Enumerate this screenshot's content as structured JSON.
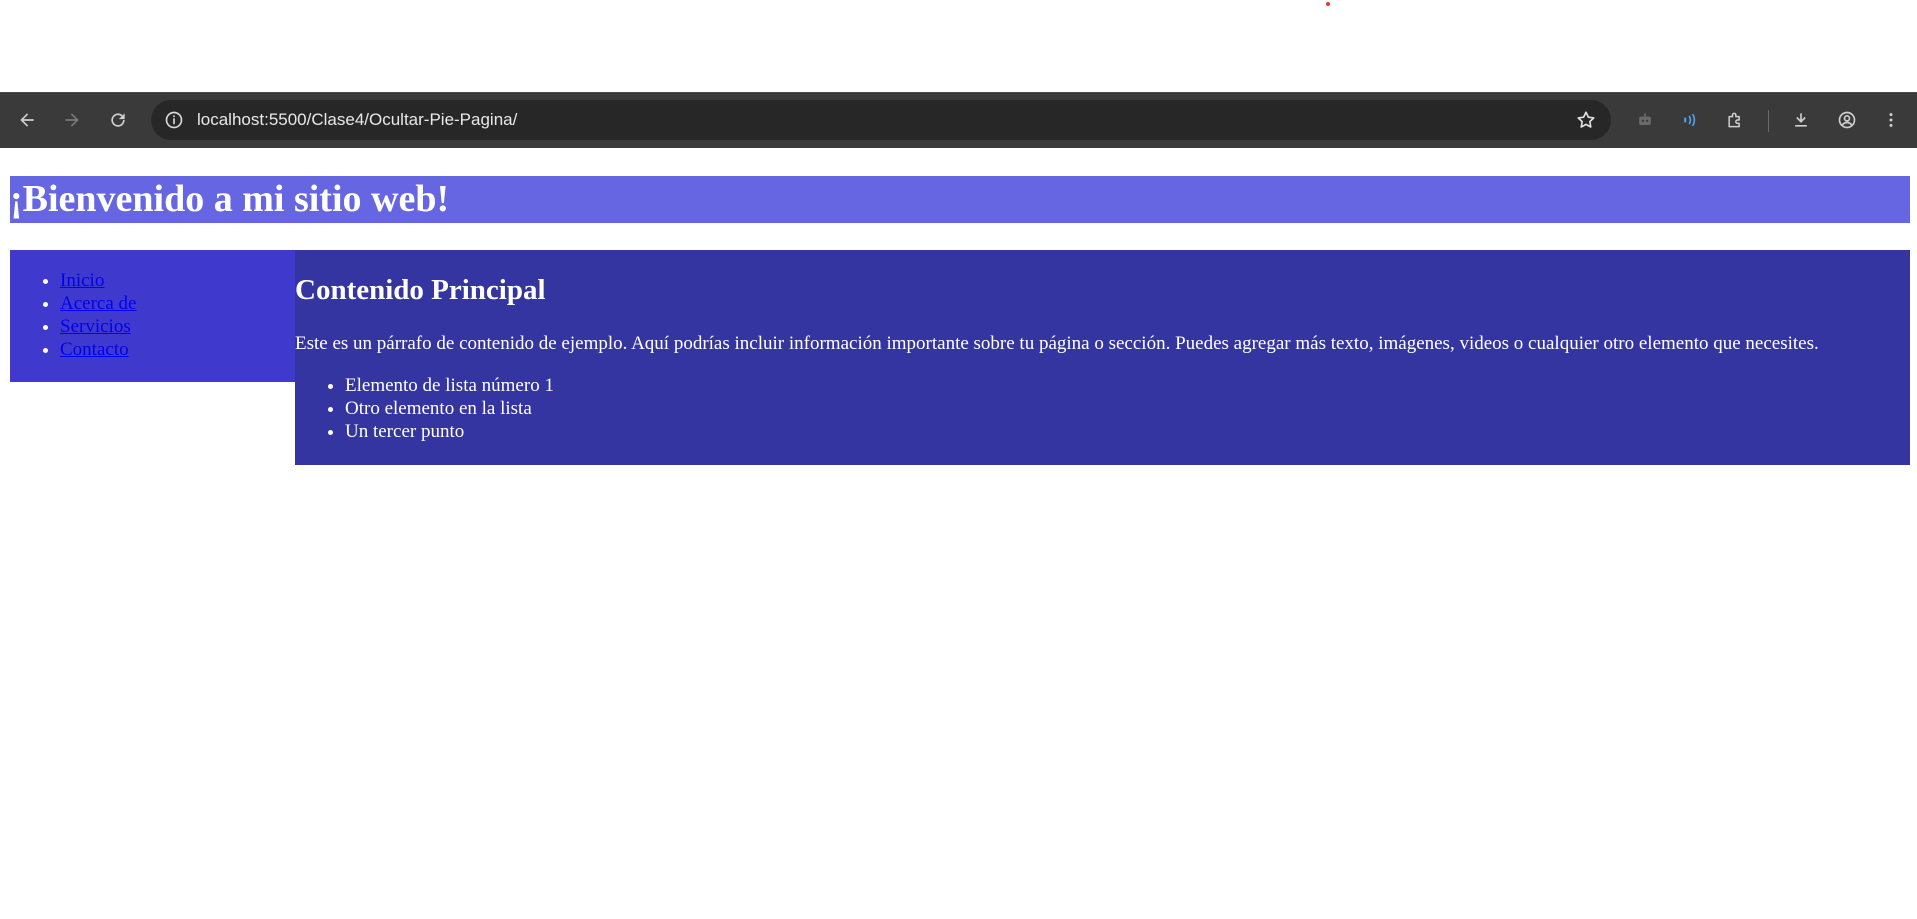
{
  "browser": {
    "url": "localhost:5500/Clase4/Ocultar-Pie-Pagina/"
  },
  "colors": {
    "toolbar": "#3a3a3a",
    "urlbar": "#272727",
    "header_bg": "#6666e2",
    "sidebar_bg": "#3f3acd",
    "main_bg": "#3535a2",
    "link": "#0000ee",
    "accent_blue": "#4aa3f0"
  },
  "header": {
    "title": "¡Bienvenido a mi sitio web!"
  },
  "sidebar": {
    "items": [
      {
        "label": "Inicio"
      },
      {
        "label": "Acerca de"
      },
      {
        "label": "Servicios"
      },
      {
        "label": "Contacto"
      }
    ]
  },
  "main": {
    "heading": "Contenido Principal",
    "paragraph": "Este es un párrafo de contenido de ejemplo. Aquí podrías incluir información importante sobre tu página o sección. Puedes agregar más texto, imágenes, videos o cualquier otro elemento que necesites.",
    "list": [
      "Elemento de lista número 1",
      "Otro elemento en la lista",
      "Un tercer punto"
    ]
  }
}
